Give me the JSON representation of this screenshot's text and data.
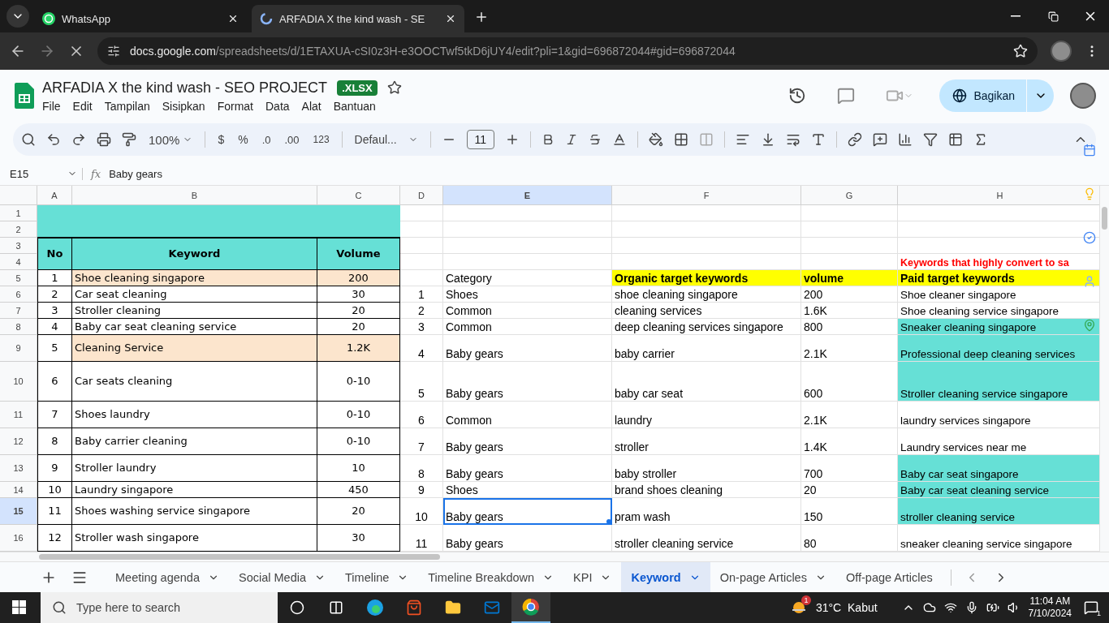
{
  "browser": {
    "tabs": [
      {
        "title": "WhatsApp",
        "kind": "whatsapp",
        "selected": false
      },
      {
        "title": "ARFADIA X the kind wash - SE",
        "kind": "docs",
        "selected": true
      }
    ],
    "url_host": "docs.google.com",
    "url_path": "/spreadsheets/d/1ETAXUA-cSI0z3H-e3OOCTwf5tkD6jUY4/edit?pli=1&gid=696872044#gid=696872044"
  },
  "document": {
    "title": "ARFADIA X the kind wash - SEO PROJECT",
    "badge": ".XLSX",
    "menu": [
      "File",
      "Edit",
      "Tampilan",
      "Sisipkan",
      "Format",
      "Data",
      "Alat",
      "Bantuan"
    ],
    "share_button": "Bagikan"
  },
  "toolbar": {
    "zoom": "100%",
    "currency": "$",
    "percent": "%",
    "decrease_decimals": ".0",
    "increase_decimals": ".00",
    "number_format": "123",
    "font": "Defaul...",
    "font_size": "11"
  },
  "formula_bar": {
    "cell": "E15",
    "fx": "fx",
    "content": "Baby gears"
  },
  "grid": {
    "columns": [
      {
        "label": "A",
        "selected": false
      },
      {
        "label": "B",
        "selected": false
      },
      {
        "label": "C",
        "selected": false
      },
      {
        "label": "D",
        "selected": false
      },
      {
        "label": "E",
        "selected": true
      },
      {
        "label": "F",
        "selected": false
      },
      {
        "label": "G",
        "selected": false
      },
      {
        "label": "H",
        "selected": false
      }
    ],
    "rows": [
      {
        "label": "1",
        "selected": false
      },
      {
        "label": "2",
        "selected": false
      },
      {
        "label": "3",
        "selected": false
      },
      {
        "label": "4",
        "selected": false
      },
      {
        "label": "5",
        "selected": false
      },
      {
        "label": "6",
        "selected": false
      },
      {
        "label": "7",
        "selected": false
      },
      {
        "label": "8",
        "selected": false
      },
      {
        "label": "9",
        "selected": false
      },
      {
        "label": "10",
        "selected": false
      },
      {
        "label": "11",
        "selected": false
      },
      {
        "label": "12",
        "selected": false
      },
      {
        "label": "13",
        "selected": false
      },
      {
        "label": "14",
        "selected": false
      },
      {
        "label": "15",
        "selected": true
      },
      {
        "label": "16",
        "selected": false
      }
    ]
  },
  "left_table": {
    "columns": [
      "No",
      "Keyword",
      "Volume"
    ],
    "rows": [
      {
        "no": "1",
        "keyword": "Shoe cleaning singapore",
        "volume": "200",
        "highlighted": true
      },
      {
        "no": "2",
        "keyword": "Car seat cleaning",
        "volume": "30",
        "highlighted": false
      },
      {
        "no": "3",
        "keyword": "Stroller cleaning",
        "volume": "20",
        "highlighted": false
      },
      {
        "no": "4",
        "keyword": "Baby car seat cleaning service",
        "volume": "20",
        "highlighted": false
      },
      {
        "no": "5",
        "keyword": "Cleaning Service",
        "volume": "1.2K",
        "highlighted": true
      },
      {
        "no": "6",
        "keyword": "Car seats cleaning",
        "volume": "0-10",
        "highlighted": false
      },
      {
        "no": "7",
        "keyword": "Shoes laundry",
        "volume": "0-10",
        "highlighted": false
      },
      {
        "no": "8",
        "keyword": "Baby carrier cleaning",
        "volume": "0-10",
        "highlighted": false
      },
      {
        "no": "9",
        "keyword": "Stroller laundry",
        "volume": "10",
        "highlighted": false
      },
      {
        "no": "10",
        "keyword": "Laundry singapore",
        "volume": "450",
        "highlighted": false
      },
      {
        "no": "11",
        "keyword": "Shoes washing service singapore",
        "volume": "20",
        "highlighted": false
      },
      {
        "no": "12",
        "keyword": "Stroller wash singapore",
        "volume": "30",
        "highlighted": false
      }
    ]
  },
  "right_table": {
    "note": "Keywords that highly convert to sa",
    "columns": [
      "Category",
      "Organic target keywords",
      "volume",
      "Paid target keywords"
    ],
    "rows": [
      {
        "index": "1",
        "category": "Shoes",
        "organic": "shoe cleaning singapore",
        "volume": "200",
        "paid": "Shoe cleaner singapore",
        "paid_highlighted": false,
        "selected": false
      },
      {
        "index": "2",
        "category": "Common",
        "organic": "cleaning services",
        "volume": "1.6K",
        "paid": "Shoe cleaning service singapore",
        "paid_highlighted": false,
        "selected": false
      },
      {
        "index": "3",
        "category": "Common",
        "organic": "deep cleaning services singapore",
        "volume": "800",
        "paid": "Sneaker cleaning singapore",
        "paid_highlighted": true,
        "selected": false
      },
      {
        "index": "4",
        "category": "Baby gears",
        "organic": "baby carrier",
        "volume": "2.1K",
        "paid": "Professional deep cleaning services",
        "paid_highlighted": true,
        "selected": false
      },
      {
        "index": "5",
        "category": "Baby gears",
        "organic": "baby car seat",
        "volume": "600",
        "paid": "Stroller cleaning service singapore",
        "paid_highlighted": true,
        "selected": false
      },
      {
        "index": "6",
        "category": "Common",
        "organic": "laundry",
        "volume": "2.1K",
        "paid": "laundry services singapore",
        "paid_highlighted": false,
        "selected": false
      },
      {
        "index": "7",
        "category": "Baby gears",
        "organic": "stroller",
        "volume": "1.4K",
        "paid": "Laundry services near me",
        "paid_highlighted": false,
        "selected": false
      },
      {
        "index": "8",
        "category": "Baby gears",
        "organic": "baby stroller",
        "volume": "700",
        "paid": "Baby car seat singapore",
        "paid_highlighted": true,
        "selected": false
      },
      {
        "index": "9",
        "category": "Shoes",
        "organic": "brand shoes cleaning",
        "volume": "20",
        "paid": "Baby car seat cleaning service",
        "paid_highlighted": true,
        "selected": false
      },
      {
        "index": "10",
        "category": "Baby gears",
        "organic": "pram wash",
        "volume": "150",
        "paid": "stroller cleaning service",
        "paid_highlighted": true,
        "selected": true
      },
      {
        "index": "11",
        "category": "Baby gears",
        "organic": "stroller cleaning service",
        "volume": "80",
        "paid": "sneaker cleaning service singapore",
        "paid_highlighted": false,
        "selected": false
      }
    ]
  },
  "sheet_tabs": [
    {
      "label": "Meeting agenda",
      "selected": false,
      "dropdown": true
    },
    {
      "label": "Social Media",
      "selected": false,
      "dropdown": true
    },
    {
      "label": "Timeline",
      "selected": false,
      "dropdown": true
    },
    {
      "label": "Timeline Breakdown",
      "selected": false,
      "dropdown": true
    },
    {
      "label": "KPI",
      "selected": false,
      "dropdown": true
    },
    {
      "label": "Keyword",
      "selected": true,
      "dropdown": true
    },
    {
      "label": "On-page Articles",
      "selected": false,
      "dropdown": true
    },
    {
      "label": "Off-page Articles",
      "selected": false,
      "dropdown": false
    }
  ],
  "taskbar": {
    "search_placeholder": "Type here to search",
    "weather_badge": "1",
    "weather": "31°C  Kabut",
    "time": "11:04 AM",
    "date": "7/10/2024",
    "notifications": "1"
  }
}
